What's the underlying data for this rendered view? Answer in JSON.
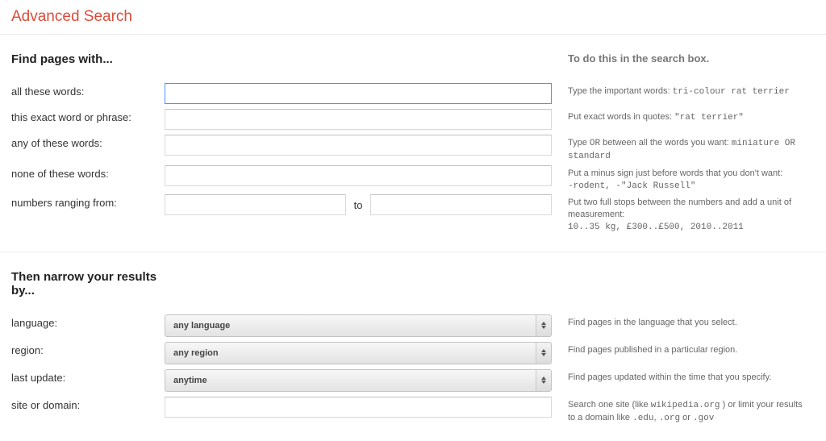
{
  "title": "Advanced Search",
  "section1": {
    "heading": "Find pages with...",
    "hintHeading": "To do this in the search box.",
    "rows": {
      "allWords": {
        "label": "all these words:",
        "hintPrefix": "Type the important words: ",
        "hintCode": "tri-colour rat terrier"
      },
      "exactPhrase": {
        "label": "this exact word or phrase:",
        "hintPrefix": "Put exact words in quotes: ",
        "hintCode": "\"rat terrier\""
      },
      "anyWords": {
        "label": "any of these words:",
        "hintPrefix1": "Type ",
        "hintCode1": "OR",
        "hintPrefix2": " between all the words you want: ",
        "hintCode2": "miniature OR standard"
      },
      "noneWords": {
        "label": "none of these words:",
        "hintLine1": "Put a minus sign just before words that you don't want:",
        "hintCode": "-rodent, -\"Jack Russell\""
      },
      "range": {
        "label": "numbers ranging from:",
        "to": "to",
        "hintLine1": "Put two full stops between the numbers and add a unit of measurement:",
        "hintCode": "10..35 kg, £300..£500, 2010..2011"
      }
    }
  },
  "section2": {
    "heading": "Then narrow your results by...",
    "rows": {
      "language": {
        "label": "language:",
        "selected": "any language",
        "hint": "Find pages in the language that you select."
      },
      "region": {
        "label": "region:",
        "selected": "any region",
        "hint": "Find pages published in a particular region."
      },
      "lastUpdate": {
        "label": "last update:",
        "selected": "anytime",
        "hint": "Find pages updated within the time that you specify."
      },
      "siteDomain": {
        "label": "site or domain:",
        "hintP1": "Search one site (like ",
        "hintC1": "wikipedia.org",
        "hintP2": " ) or limit your results to a domain like ",
        "hintC2": ".edu",
        "hintP3": ", ",
        "hintC3": ".org",
        "hintP4": " or ",
        "hintC4": ".gov"
      }
    }
  }
}
